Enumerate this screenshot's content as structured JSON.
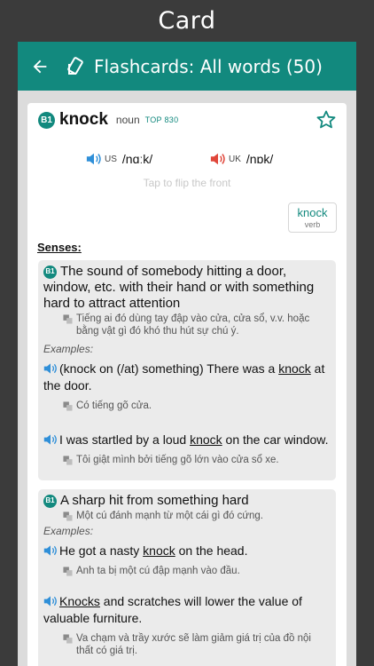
{
  "caption": "Card",
  "appbar": {
    "title": "Flashcards: All words (50)"
  },
  "entry": {
    "level": "B1",
    "word": "knock",
    "pos": "noun",
    "rank": "TOP 830",
    "us_label": "US",
    "us_ipa": "/nɑːk/",
    "uk_label": "UK",
    "uk_ipa": "/nɒk/",
    "tap_hint": "Tap to flip the front",
    "related": {
      "word": "knock",
      "pos": "verb"
    },
    "senses_label": "Senses:",
    "examples_label": "Examples:"
  },
  "senses": [
    {
      "level": "B1",
      "definition": "The sound of somebody hitting a door, window, etc. with their hand or with something hard to attract attention",
      "translation": "Tiếng ai đó dùng tay đập vào cửa, cửa sổ, v.v. hoặc bằng vật gì đó khó thu hút sự chú ý.",
      "examples": [
        {
          "pre": "(knock on (/at) something) There was a ",
          "key": "knock",
          "post": " at the door.",
          "translation": "Có tiếng gõ cửa."
        },
        {
          "pre": "I was startled by a loud ",
          "key": "knock",
          "post": " on the car window.",
          "translation": "Tôi giật mình bởi tiếng gõ lớn vào cửa sổ xe."
        }
      ]
    },
    {
      "level": "B1",
      "definition": "A sharp hit from something hard",
      "translation": "Một cú đánh mạnh từ một cái gì đó cứng.",
      "examples": [
        {
          "pre": "He got a nasty ",
          "key": "knock",
          "post": " on the head.",
          "translation": "Anh ta bị một cú đập mạnh vào đầu."
        },
        {
          "pre": "",
          "key": "Knocks",
          "post": " and scratches will lower the value of valuable furniture.",
          "translation": "Va chạm và trầy xước sẽ làm giảm giá trị của đồ nội thất có giá trị."
        }
      ]
    }
  ],
  "colors": {
    "accent": "#12897e",
    "us_speaker": "#2f8fd8",
    "uk_speaker": "#e0463a"
  }
}
